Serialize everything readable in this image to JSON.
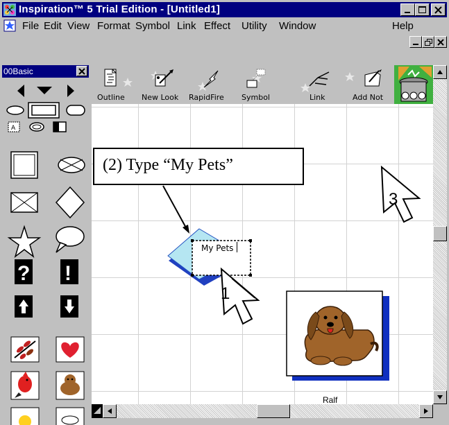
{
  "window": {
    "title": "Inspiration™ 5 Trial Edition - [Untitled1]",
    "colors": {
      "title_bar": "#000080",
      "chrome": "#c0c0c0",
      "selection_fill": "#b5e6f2"
    }
  },
  "menu": {
    "items": [
      {
        "label": "File"
      },
      {
        "label": "Edit"
      },
      {
        "label": "View"
      },
      {
        "label": "Format"
      },
      {
        "label": "Symbol"
      },
      {
        "label": "Link"
      },
      {
        "label": "Effect"
      },
      {
        "label": "Utility"
      },
      {
        "label": "Window"
      },
      {
        "label": "Help"
      }
    ]
  },
  "palette": {
    "title": "00Basic"
  },
  "toolbar": {
    "items": [
      {
        "label": "Outline",
        "icon": "outline-icon"
      },
      {
        "label": "New Look",
        "icon": "new-look-icon"
      },
      {
        "label": "RapidFire",
        "icon": "rapidfire-icon"
      },
      {
        "label": "Symbol",
        "icon": "symbol-icon"
      },
      {
        "label": "Link",
        "icon": "link-icon"
      },
      {
        "label": "Add Not",
        "icon": "add-note-icon"
      }
    ]
  },
  "canvas": {
    "callout": "(2) Type “My Pets”",
    "symbol_text": "My Pets",
    "dog_label": "Ralf",
    "step_1": "1",
    "step_3": "3"
  }
}
